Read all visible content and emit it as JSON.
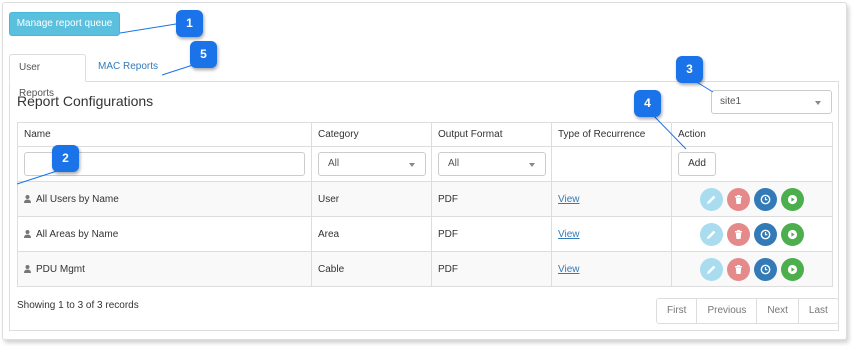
{
  "toolbar": {
    "manage_queue_label": "Manage report queue"
  },
  "tabs": [
    {
      "label": "User Reports",
      "active": true
    },
    {
      "label": "MAC Reports",
      "active": false
    }
  ],
  "panel": {
    "title": "Report Configurations"
  },
  "site_select": {
    "value": "site1"
  },
  "table": {
    "columns": [
      "Name",
      "Category",
      "Output Format",
      "Type of Recurrence",
      "Action"
    ],
    "filters": {
      "name_value": "",
      "category_value": "All",
      "output_value": "All",
      "add_label": "Add"
    },
    "rows": [
      {
        "name": "All Users by Name",
        "category": "User",
        "format": "PDF",
        "recurrence": "View"
      },
      {
        "name": "All Areas by Name",
        "category": "Area",
        "format": "PDF",
        "recurrence": "View"
      },
      {
        "name": "PDU Mgmt",
        "category": "Cable",
        "format": "PDF",
        "recurrence": "View"
      }
    ]
  },
  "footer": {
    "showing": "Showing 1 to 3 of 3 records",
    "pager": [
      "First",
      "Previous",
      "Next",
      "Last"
    ]
  },
  "callouts": [
    "1",
    "2",
    "3",
    "4",
    "5"
  ],
  "colors": {
    "info_button": "#5bc0de",
    "link": "#337ab7",
    "callout": "#1a73e8",
    "edit": "#a8dcee",
    "delete": "#e58a8a",
    "schedule": "#337ab7",
    "run": "#4cae4c"
  },
  "icons": {
    "row": "user-icon",
    "actions": [
      "pencil-icon",
      "trash-icon",
      "clock-icon",
      "play-icon"
    ]
  }
}
